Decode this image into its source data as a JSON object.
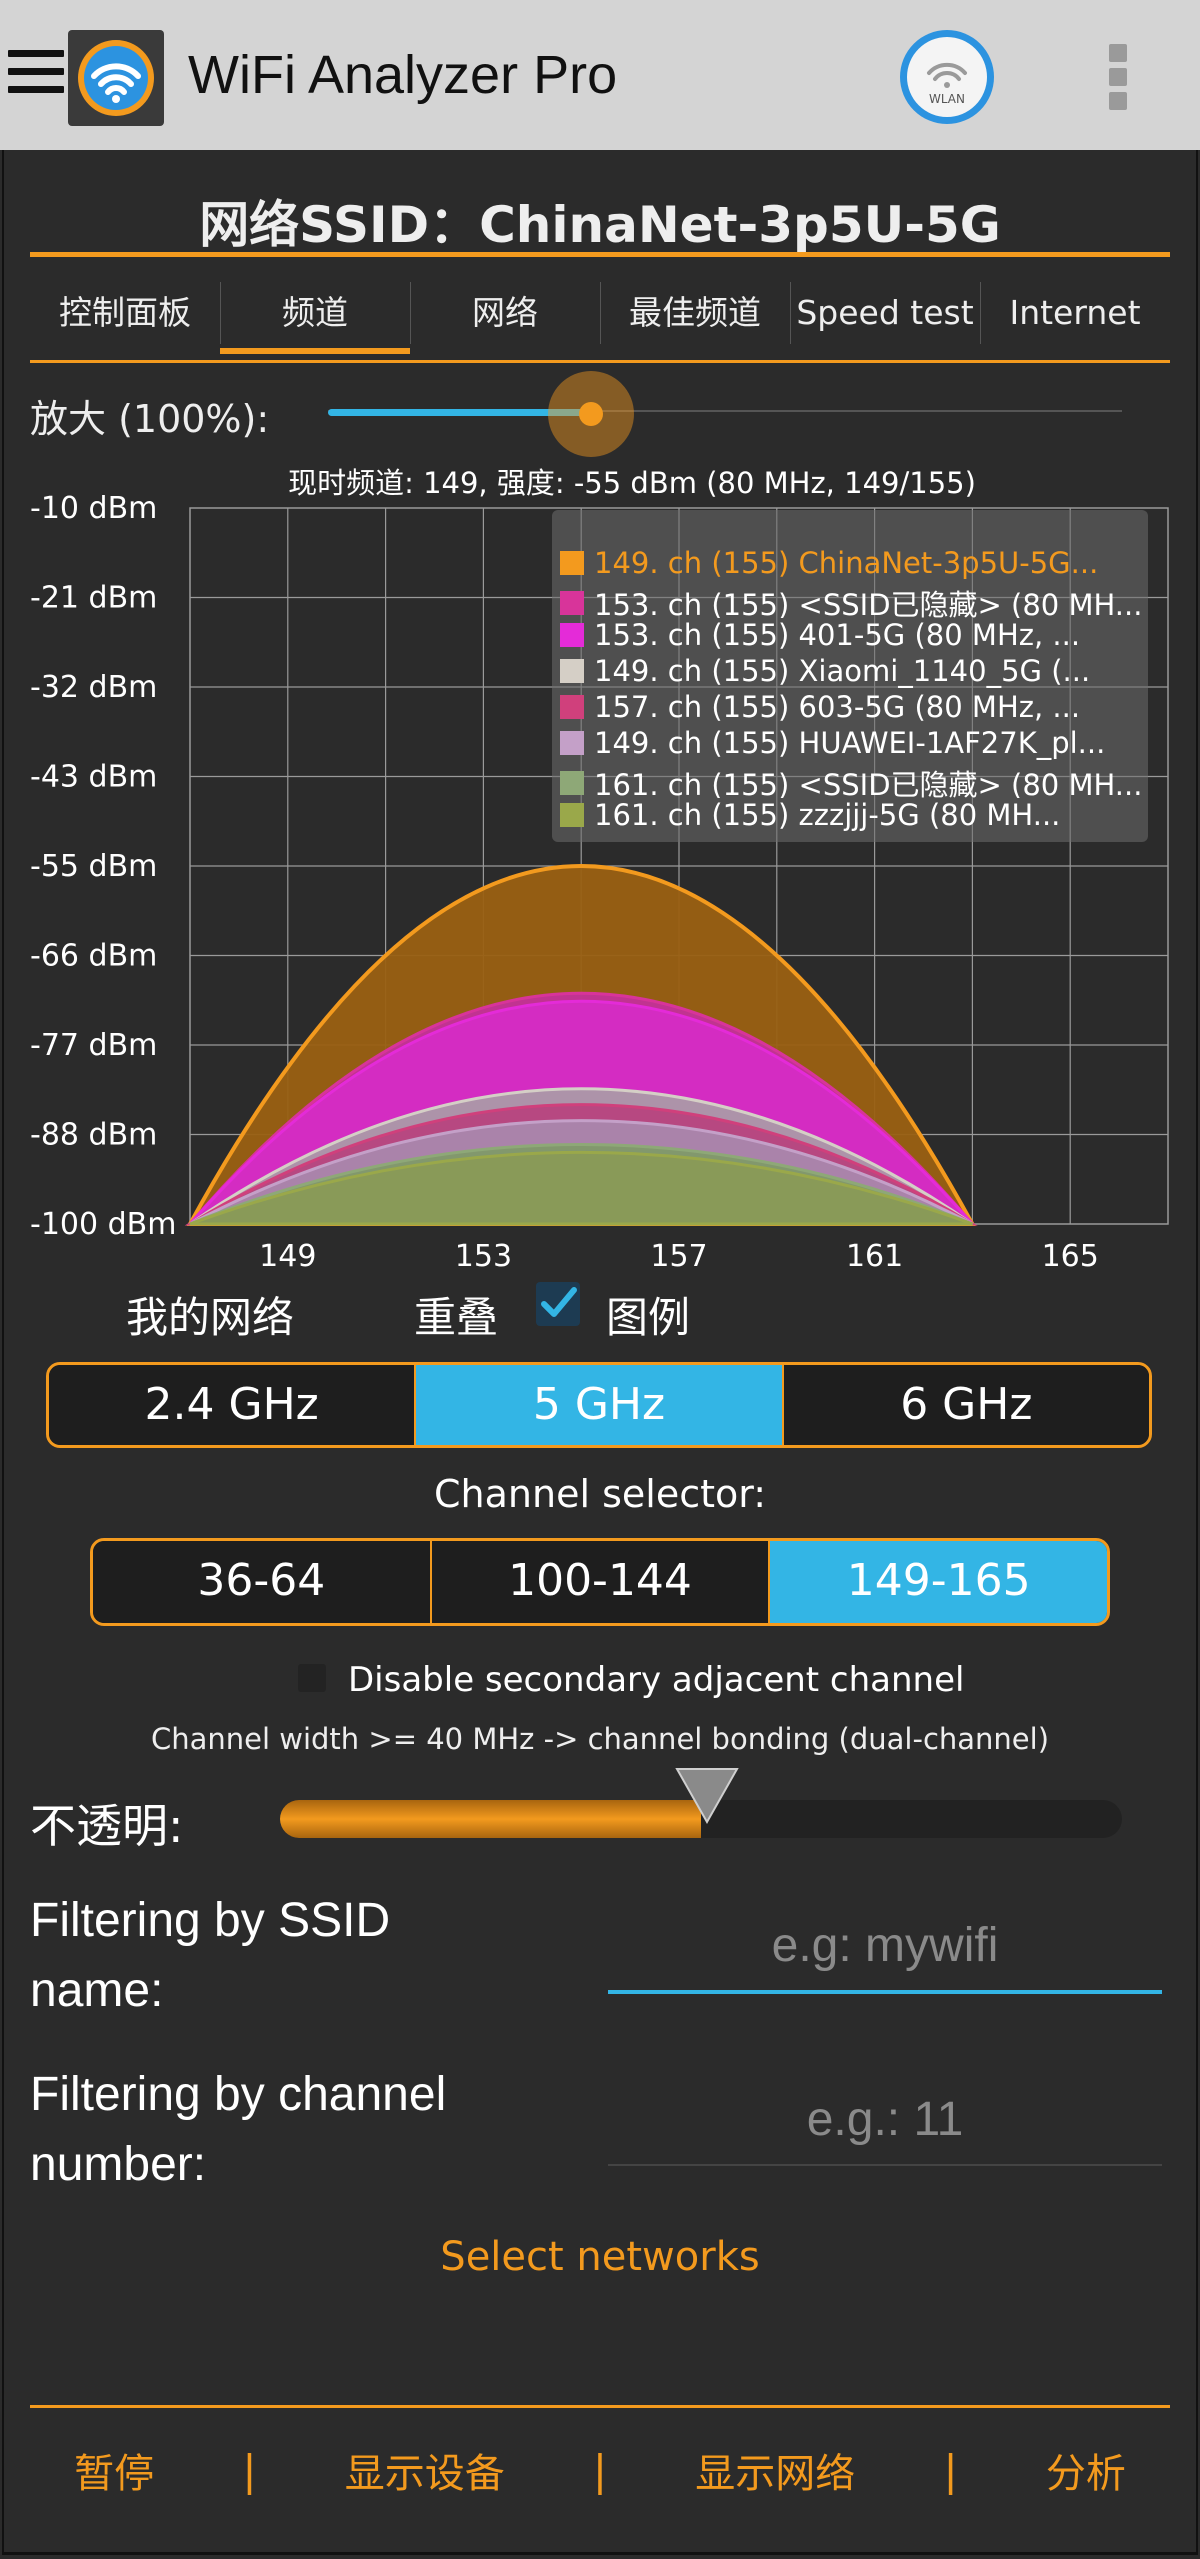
{
  "app": {
    "title": "WiFi Analyzer Pro",
    "wlan_label": "WLAN",
    "colors": {
      "accent": "#f39a1e",
      "selection": "#33b5e5",
      "appbar": "#d4d4d4"
    }
  },
  "header": {
    "ssid_title": "网络SSID：ChinaNet-3p5U-5G"
  },
  "tabs": [
    {
      "label": "控制面板",
      "active": false
    },
    {
      "label": "频道",
      "active": true
    },
    {
      "label": "网络",
      "active": false
    },
    {
      "label": "最佳频道",
      "active": false
    },
    {
      "label": "Speed test",
      "active": false
    },
    {
      "label": "Internet",
      "active": false
    }
  ],
  "zoom": {
    "label": "放大 (100%):",
    "value": 0.33
  },
  "chart_data": {
    "type": "area",
    "title": "现时频道: 149, 强度: -55 dBm (80 MHz, 149/155)",
    "y_ticks": [
      "-10 dBm",
      "-21 dBm",
      "-32 dBm",
      "-43 dBm",
      "-55 dBm",
      "-66 dBm",
      "-77 dBm",
      "-88 dBm",
      "-100 dBm"
    ],
    "x_ticks": [
      "149",
      "153",
      "157",
      "161",
      "165"
    ],
    "ylim": [
      -100,
      -10
    ],
    "x_range": [
      147,
      167
    ],
    "grid": true,
    "legend_position": "top-right",
    "series": [
      {
        "name": "149. ch (155) ChinaNet-3p5U-5G...",
        "color": "#f39a1e",
        "fill": "#9a6012",
        "center": 155,
        "width_channels": 16,
        "peak": -55,
        "text_color": "#f39a1e"
      },
      {
        "name": "153. ch (155) <SSID已隐藏> (80 MH...",
        "color": "#d8349a",
        "fill": "#c52fa0",
        "center": 155,
        "width_channels": 16,
        "peak": -71
      },
      {
        "name": "153. ch (155) 401-5G (80 MHz, ...",
        "color": "#e42bd8",
        "fill": "#d62bc8",
        "center": 155,
        "width_channels": 16,
        "peak": -72
      },
      {
        "name": "149. ch (155) Xiaomi_1140_5G (...",
        "color": "#d5cfc6",
        "fill": "#a89ea6",
        "center": 155,
        "width_channels": 16,
        "peak": -83
      },
      {
        "name": "157. ch (155) 603-5G (80 MHz, ...",
        "color": "#d0407c",
        "fill": "#b8407c",
        "center": 155,
        "width_channels": 16,
        "peak": -85
      },
      {
        "name": "149. ch (155) HUAWEI-1AF27K_pl...",
        "color": "#c4a0c8",
        "fill": "#a88aae",
        "center": 155,
        "width_channels": 16,
        "peak": -87
      },
      {
        "name": "161. ch (155) <SSID已隐藏> (80 MH...",
        "color": "#8ea877",
        "fill": "#7d9a66",
        "center": 155,
        "width_channels": 16,
        "peak": -90
      },
      {
        "name": "161. ch (155) zzzjjj-5G (80 MH...",
        "color": "#9aa84a",
        "fill": "#8a9a55",
        "center": 155,
        "width_channels": 16,
        "peak": -91
      }
    ]
  },
  "options": {
    "my_networks": "我的网络",
    "overlap": "重叠",
    "legend": "图例",
    "legend_checked": true
  },
  "bands": [
    {
      "label": "2.4 GHz",
      "active": false
    },
    {
      "label": "5 GHz",
      "active": true
    },
    {
      "label": "6 GHz",
      "active": false
    }
  ],
  "channel_selector": {
    "label": "Channel selector:",
    "ranges": [
      {
        "label": "36-64",
        "active": false
      },
      {
        "label": "100-144",
        "active": false
      },
      {
        "label": "149-165",
        "active": true
      }
    ]
  },
  "secondary": {
    "disable_label": "Disable secondary adjacent channel",
    "checked": false,
    "bonding_note": "Channel width >= 40 MHz -> channel bonding (dual-channel)"
  },
  "opacity": {
    "label": "不透明:",
    "value": 0.5
  },
  "filters": {
    "ssid_label": "Filtering by SSID name:",
    "ssid_placeholder": "e.g: mywifi",
    "channel_label": "Filtering by channel number:",
    "channel_placeholder": "e.g.: 11"
  },
  "select_networks": "Select networks",
  "bottom_bar": {
    "pause": "暂停",
    "show_devices": "显示设备",
    "show_networks": "显示网络",
    "analyze": "分析",
    "separator": "|"
  }
}
